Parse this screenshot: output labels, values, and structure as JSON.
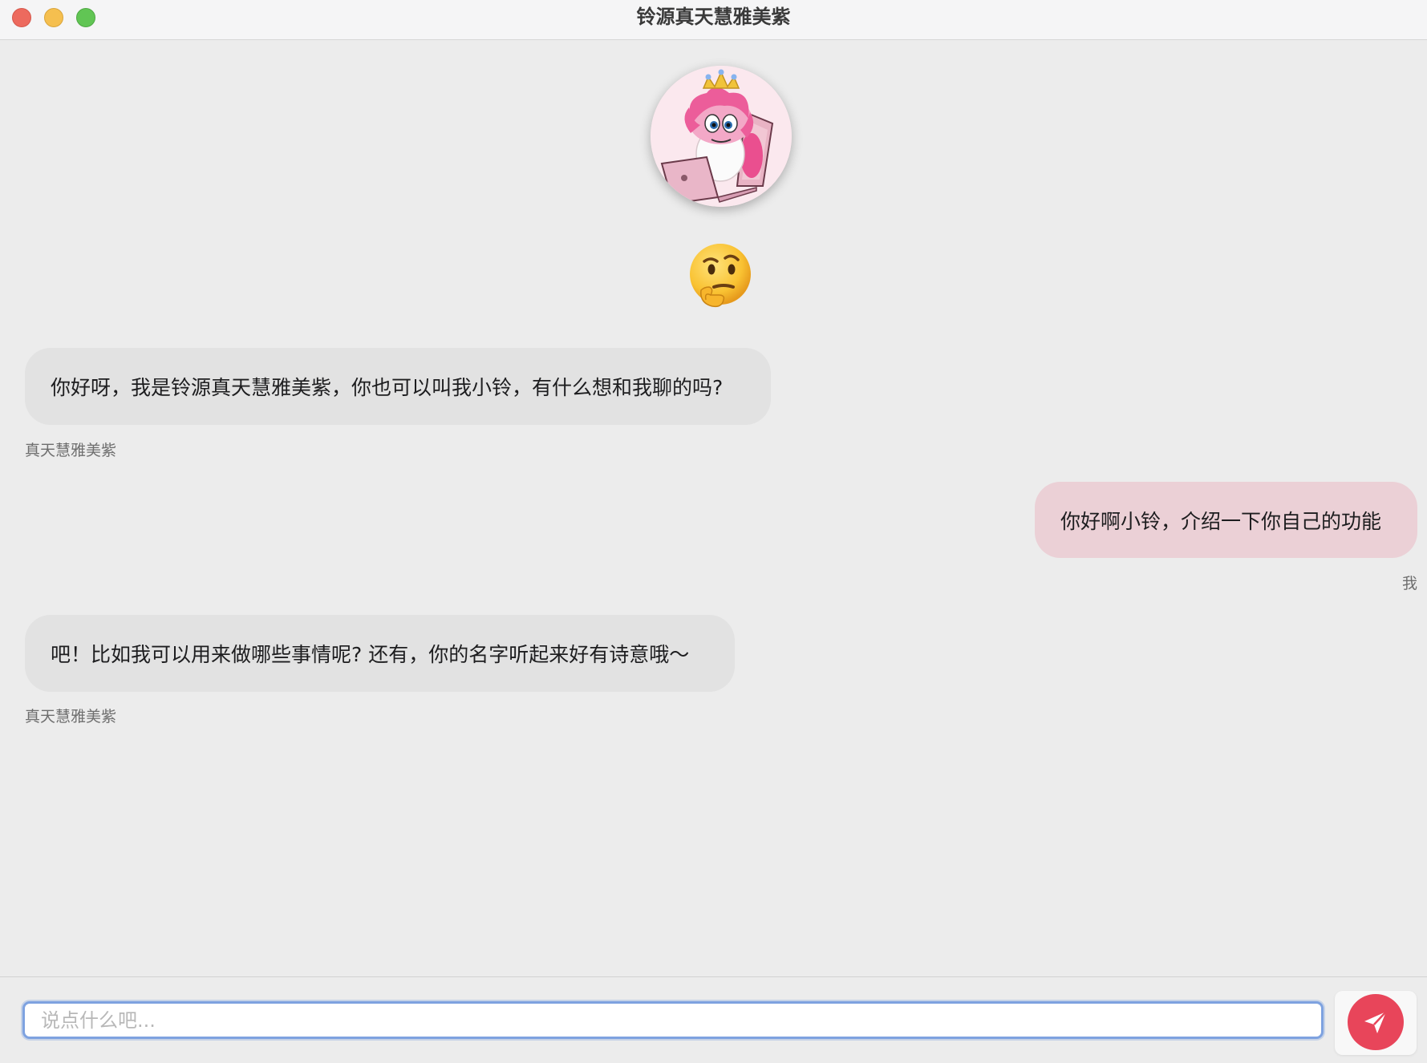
{
  "window": {
    "title": "铃源真天慧雅美紫"
  },
  "avatar": {
    "icon": "pink-pony-with-crown-and-laptop"
  },
  "status": {
    "icon": "thinking-face-emoji"
  },
  "messages": [
    {
      "role": "bot",
      "text": "你好呀，我是铃源真天慧雅美紫，你也可以叫我小铃，有什么想和我聊的吗?",
      "sender": "真天慧雅美紫"
    },
    {
      "role": "user",
      "text": "你好啊小铃，介绍一下你自己的功能",
      "sender": "我"
    },
    {
      "role": "bot",
      "text": "吧！比如我可以用来做哪些事情呢? 还有，你的名字听起来好有诗意哦～",
      "sender": "真天慧雅美紫"
    }
  ],
  "composer": {
    "placeholder": "说点什么吧...",
    "value": "",
    "send_icon": "paper-plane-icon"
  },
  "colors": {
    "bot_bubble": "#e2e2e2",
    "user_bubble": "#ebd0d6",
    "send_button": "#e8455a",
    "input_focus": "#7ea2e0"
  }
}
